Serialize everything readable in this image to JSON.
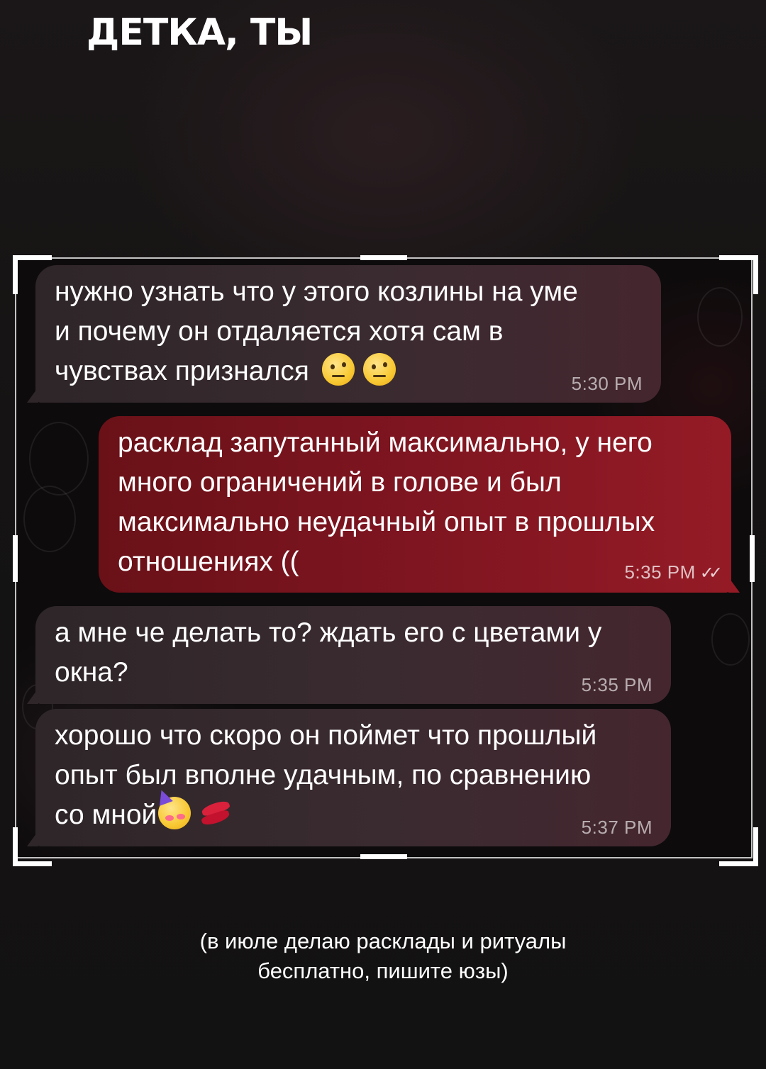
{
  "headline": "ДЕТКА, ТЫ",
  "chat": {
    "messages": [
      {
        "direction": "incoming",
        "lines": [
          "нужно узнать что у этого козлины на уме",
          "и почему он отдаляется хотя сам в",
          "чувствах признался"
        ],
        "emojis": [
          "face-with-raised-eyebrow-icon",
          "face-with-raised-eyebrow-icon"
        ],
        "time": "5:30 PM"
      },
      {
        "direction": "outgoing",
        "lines": [
          "расклад запутанный максимально, у него",
          "много ограничений в голове и был",
          "максимально неудачный опыт в прошлых",
          "отношениях (("
        ],
        "time": "5:35 PM",
        "status": "double-check-icon"
      },
      {
        "direction": "incoming",
        "lines": [
          "а мне че делать то? ждать его с цветами у",
          "окна?"
        ],
        "time": "5:35 PM"
      },
      {
        "direction": "incoming",
        "lines": [
          "хорошо что скоро он поймет что прошлый",
          "опыт был вполне удачным, по сравнению",
          "со мной"
        ],
        "emojis": [
          "partying-face-icon",
          "kiss-mark-icon"
        ],
        "time": "5:37 PM"
      }
    ]
  },
  "caption": {
    "line1": "(в июле делаю расклады и ритуалы",
    "line2": "бесплатно, пишите юзы)"
  },
  "colors": {
    "incoming_bubble": "#3a2b30",
    "outgoing_bubble": "#7e1520",
    "background": "#131212",
    "text": "#ffffff"
  }
}
